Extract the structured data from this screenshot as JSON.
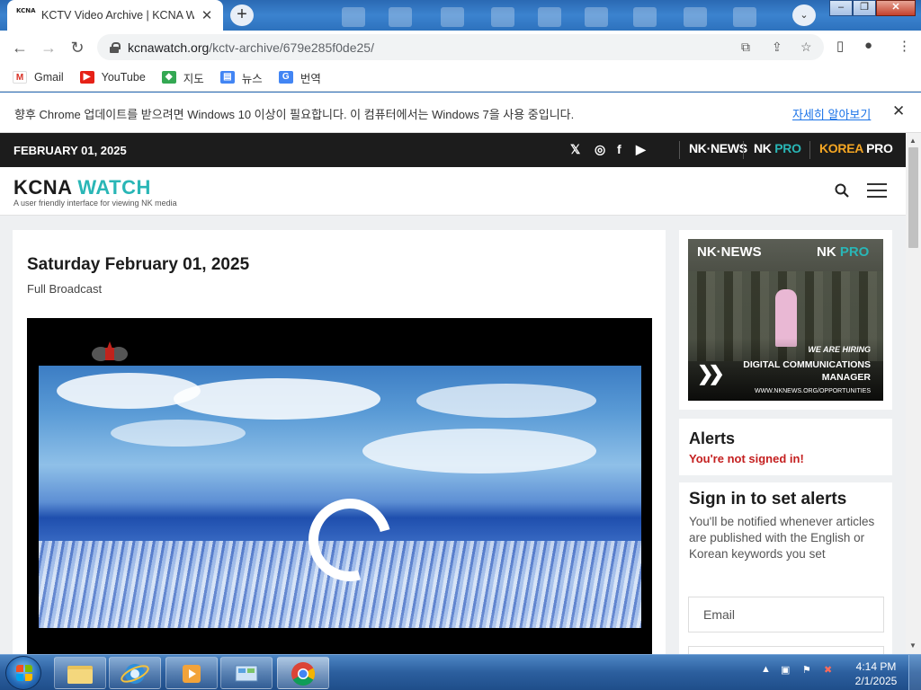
{
  "browser": {
    "tab_title": "KCTV Video Archive | KCNA Watch",
    "tab_favicon": "KCNA",
    "url_host": "kcnawatch.org",
    "url_path": "/kctv-archive/679e285f0de25/",
    "bookmarks": [
      {
        "label": "Gmail",
        "icon": "gmail-icon",
        "color": "#d93025"
      },
      {
        "label": "YouTube",
        "icon": "youtube-icon",
        "color": "#e62117"
      },
      {
        "label": "지도",
        "icon": "maps-icon",
        "color": "#34a853"
      },
      {
        "label": "뉴스",
        "icon": "news-icon",
        "color": "#4285f4"
      },
      {
        "label": "번역",
        "icon": "translate-icon",
        "color": "#4285f4"
      }
    ],
    "infobar_text": "향후 Chrome 업데이트를 받으려면 Windows 10 이상이 필요합니다. 이 컴퓨터에서는 Windows 7을 사용 중입니다.",
    "infobar_link": "자세히 알아보기"
  },
  "site": {
    "date": "FEBRUARY 01, 2025",
    "brands": {
      "nknews": "NK·NEWS",
      "nkpro_nk": "NK",
      "nkpro_pro": "PRO",
      "korea": "KOREA",
      "korea_pro": "PRO"
    },
    "logo_main": "KCNA",
    "logo_accent": "WATCH",
    "tagline": "A user friendly interface for viewing NK media"
  },
  "main": {
    "title": "Saturday February 01, 2025",
    "subtitle": "Full Broadcast"
  },
  "ad": {
    "nknews": "NK·NEWS",
    "nkpro_nk": "NK",
    "nkpro_pro": "PRO",
    "hiring": "WE ARE HIRING",
    "role_line1": "DIGITAL COMMUNICATIONS",
    "role_line2": "MANAGER",
    "url": "WWW.NKNEWS.ORG/OPPORTUNITIES"
  },
  "alerts": {
    "heading": "Alerts",
    "warning": "You're not signed in!",
    "signin_heading": "Sign in to set alerts",
    "signin_text": "You'll be notified whenever articles are published with the English or Korean keywords you set",
    "email_placeholder": "Email"
  },
  "taskbar": {
    "time": "4:14 PM",
    "date": "2/1/2025"
  },
  "colors": {
    "accent": "#29b6b6",
    "brand_orange": "#f5a623",
    "warning_red": "#c41f1f"
  }
}
